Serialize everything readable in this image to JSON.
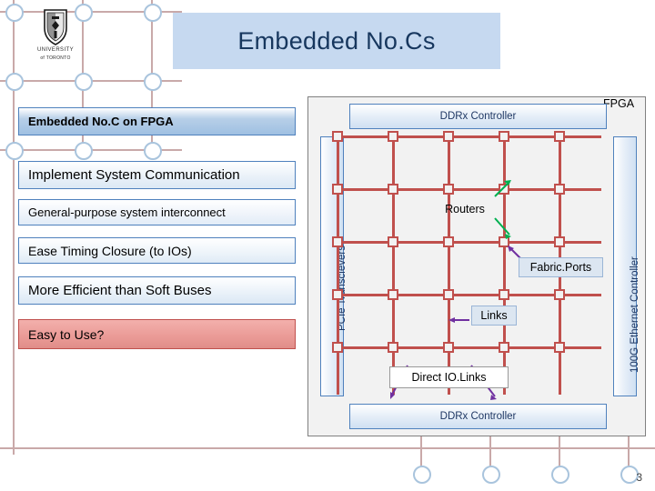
{
  "slide": {
    "title": "Embedded No.Cs",
    "page_number": "3"
  },
  "logo": {
    "line1": "UNIVERSITY",
    "line2": "of TORONTO",
    "alt": "university-of-toronto-crest"
  },
  "bullets": [
    {
      "label": "Embedded No.C on FPGA"
    },
    {
      "label": "Implement System Communication"
    },
    {
      "label": "General-purpose system interconnect"
    },
    {
      "label": "Ease Timing Closure (to IOs)"
    },
    {
      "label": "More Efficient than Soft Buses"
    },
    {
      "label": "Easy to Use?"
    }
  ],
  "diagram": {
    "fpga_label": "FPGA",
    "ddr_top": "DDRx Controller",
    "ddr_bottom": "DDRx Controller",
    "left_side": "PCIe Transcievers",
    "right_side": "100G Ethernet Controller",
    "callouts": {
      "routers": "Routers",
      "fabric_ports": "Fabric.Ports",
      "links": "Links",
      "direct_io": "Direct IO.Links"
    },
    "grid": {
      "cols": 5,
      "rows": 5
    },
    "colors": {
      "link": "#c0504d",
      "box_fill": "#dce6f1",
      "box_border": "#4f81bd",
      "title_bg": "#c6d9f0",
      "title_fg": "#17375e",
      "highlight": "#e08d88"
    }
  }
}
